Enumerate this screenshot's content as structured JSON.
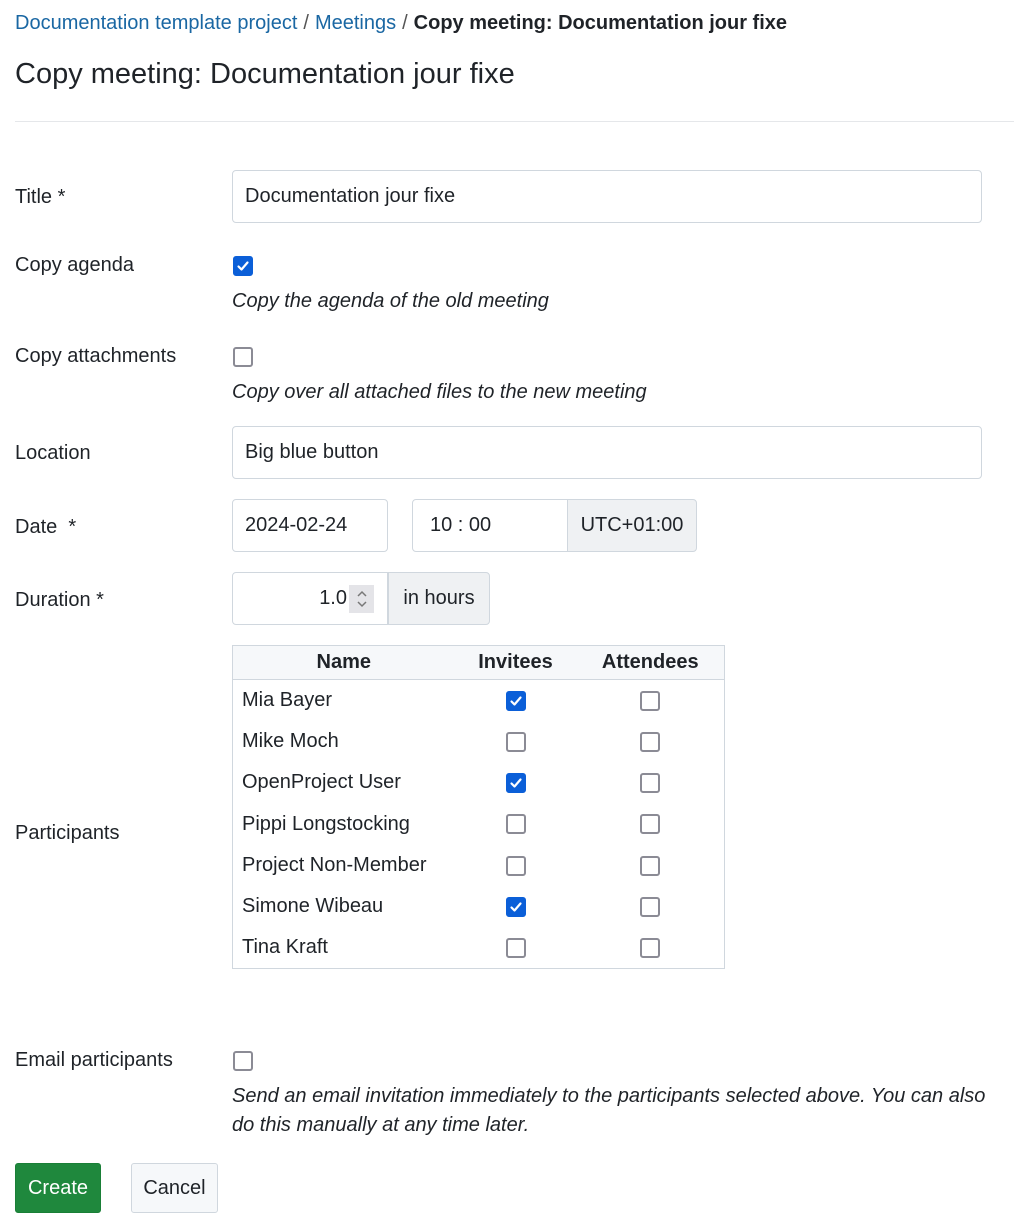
{
  "breadcrumb": {
    "items": [
      {
        "label": "Documentation template project"
      },
      {
        "label": "Meetings"
      }
    ],
    "separator": "/",
    "current": "Copy meeting: Documentation jour fixe"
  },
  "page_title": "Copy meeting: Documentation jour fixe",
  "form": {
    "title": {
      "label": "Title",
      "required": "*",
      "value": "Documentation jour fixe"
    },
    "copy_agenda": {
      "label": "Copy agenda",
      "checked": true,
      "hint": "Copy the agenda of the old meeting"
    },
    "copy_attachments": {
      "label": "Copy attachments",
      "checked": false,
      "hint": "Copy over all attached files to the new meeting"
    },
    "location": {
      "label": "Location",
      "value": "Big blue button"
    },
    "date": {
      "label": "Date",
      "required": "*",
      "date_value": "2024-02-24",
      "time_value": "10 : 00",
      "timezone": "UTC+01:00"
    },
    "duration": {
      "label": "Duration",
      "required": "*",
      "value": "1.0",
      "unit": "in hours"
    },
    "participants": {
      "label": "Participants",
      "columns": [
        "Name",
        "Invitees",
        "Attendees"
      ],
      "rows": [
        {
          "name": "Mia Bayer",
          "invited": true,
          "attended": false
        },
        {
          "name": "Mike Moch",
          "invited": false,
          "attended": false
        },
        {
          "name": "OpenProject User",
          "invited": true,
          "attended": false
        },
        {
          "name": "Pippi Longstocking",
          "invited": false,
          "attended": false
        },
        {
          "name": "Project Non-Member",
          "invited": false,
          "attended": false
        },
        {
          "name": "Simone Wibeau",
          "invited": true,
          "attended": false
        },
        {
          "name": "Tina Kraft",
          "invited": false,
          "attended": false
        }
      ]
    },
    "email_participants": {
      "label": "Email participants",
      "checked": false,
      "hint": "Send an email invitation immediately to the participants selected above. You can also do this manually at any time later."
    }
  },
  "buttons": {
    "create": "Create",
    "cancel": "Cancel"
  },
  "colors": {
    "link": "#1a67a3",
    "checkbox_checked": "#0b5fd8",
    "primary_button": "#1f883d"
  }
}
